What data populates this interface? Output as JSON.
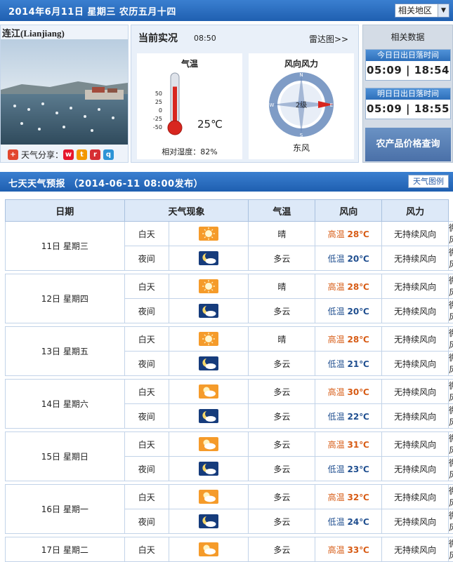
{
  "header": {
    "date_line": "2014年6月11日  星期三  农历五月十四",
    "region_select": "相关地区"
  },
  "city": {
    "name": "连江(Lianjiang)",
    "share_label": "天气分享："
  },
  "current": {
    "title": "当前实况",
    "time": "08:50",
    "radar_link": "雷达图>>",
    "temp_title": "气温",
    "temp_value": "25℃",
    "scale": [
      "50",
      "25",
      "0",
      "-25",
      "-50"
    ],
    "humidity": "相对湿度：82%",
    "temperature_c": 25,
    "wind_title": "风向风力",
    "wind_level": "2级",
    "wind_dir": "东风",
    "compass": [
      "N",
      "E",
      "S",
      "W"
    ]
  },
  "related": {
    "title": "相关数据",
    "today_label": "今日日出日落时间",
    "today_times": "05:09 | 18:54",
    "tomorrow_label": "明日日出日落时间",
    "tomorrow_times": "05:09 | 18:55",
    "price_button": "农产品价格查询"
  },
  "forecast": {
    "title": "七天天气预报 （2014-06-11 08:00发布）",
    "legend_button": "天气图例",
    "headers": [
      "日期",
      "天气现象",
      "气温",
      "风向",
      "风力"
    ],
    "days": [
      {
        "date": "11日 星期三",
        "day": {
          "period": "白天",
          "weather": "晴",
          "icon": "sunny-icon",
          "label": "高温",
          "temp": "28℃",
          "wind_dir": "无持续风向",
          "wind": "微风"
        },
        "night": {
          "period": "夜间",
          "weather": "多云",
          "icon": "cloudy-night-icon",
          "label": "低温",
          "temp": "20℃",
          "wind_dir": "无持续风向",
          "wind": "微风"
        }
      },
      {
        "date": "12日 星期四",
        "day": {
          "period": "白天",
          "weather": "晴",
          "icon": "sunny-icon",
          "label": "高温",
          "temp": "28℃",
          "wind_dir": "无持续风向",
          "wind": "微风"
        },
        "night": {
          "period": "夜间",
          "weather": "多云",
          "icon": "cloudy-night-icon",
          "label": "低温",
          "temp": "20℃",
          "wind_dir": "无持续风向",
          "wind": "微风"
        }
      },
      {
        "date": "13日 星期五",
        "day": {
          "period": "白天",
          "weather": "晴",
          "icon": "sunny-icon",
          "label": "高温",
          "temp": "28℃",
          "wind_dir": "无持续风向",
          "wind": "微风"
        },
        "night": {
          "period": "夜间",
          "weather": "多云",
          "icon": "cloudy-night-icon",
          "label": "低温",
          "temp": "21℃",
          "wind_dir": "无持续风向",
          "wind": "微风"
        }
      },
      {
        "date": "14日 星期六",
        "day": {
          "period": "白天",
          "weather": "多云",
          "icon": "cloudy-day-icon",
          "label": "高温",
          "temp": "30℃",
          "wind_dir": "无持续风向",
          "wind": "微风"
        },
        "night": {
          "period": "夜间",
          "weather": "多云",
          "icon": "cloudy-night-icon",
          "label": "低温",
          "temp": "22℃",
          "wind_dir": "无持续风向",
          "wind": "微风"
        }
      },
      {
        "date": "15日 星期日",
        "day": {
          "period": "白天",
          "weather": "多云",
          "icon": "cloudy-day-icon",
          "label": "高温",
          "temp": "31℃",
          "wind_dir": "无持续风向",
          "wind": "微风"
        },
        "night": {
          "period": "夜间",
          "weather": "多云",
          "icon": "cloudy-night-icon",
          "label": "低温",
          "temp": "23℃",
          "wind_dir": "无持续风向",
          "wind": "微风"
        }
      },
      {
        "date": "16日 星期一",
        "day": {
          "period": "白天",
          "weather": "多云",
          "icon": "cloudy-day-icon",
          "label": "高温",
          "temp": "32℃",
          "wind_dir": "无持续风向",
          "wind": "微风"
        },
        "night": {
          "period": "夜间",
          "weather": "多云",
          "icon": "cloudy-night-icon",
          "label": "低温",
          "temp": "24℃",
          "wind_dir": "无持续风向",
          "wind": "微风"
        }
      },
      {
        "date": "17日 星期二",
        "day": {
          "period": "白天",
          "weather": "多云",
          "icon": "cloudy-day-icon",
          "label": "高温",
          "temp": "33℃",
          "wind_dir": "无持续风向",
          "wind": "微风"
        }
      }
    ]
  }
}
